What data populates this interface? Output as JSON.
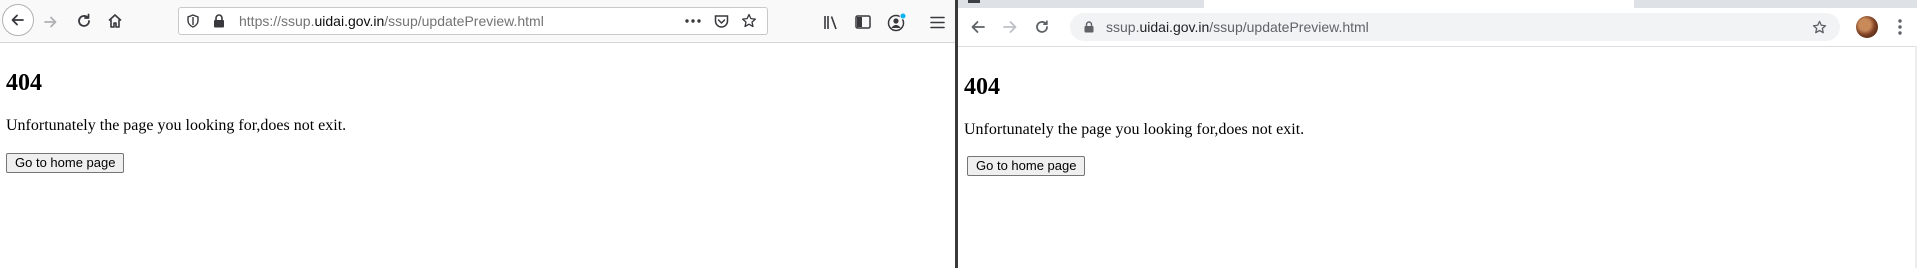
{
  "firefox": {
    "url_prefix": "https://ssup.",
    "url_domain": "uidai.gov.in",
    "url_path": "/ssup/updatePreview.html",
    "page": {
      "heading": "404",
      "message": "Unfortunately the page you looking for,does not exit.",
      "button_label": "Go to home page"
    }
  },
  "chrome": {
    "url_prefix": "ssup.",
    "url_domain": "uidai.gov.in",
    "url_path": "/ssup/updatePreview.html",
    "page": {
      "heading": "404",
      "message": "Unfortunately the page you looking for,does not exit.",
      "button_label": "Go to home page"
    }
  },
  "icons": {
    "firefox": [
      "back-icon",
      "forward-icon",
      "reload-icon",
      "home-icon",
      "shield-icon",
      "lock-icon",
      "more-actions-icon",
      "pocket-icon",
      "bookmark-star-icon",
      "library-icon",
      "sidebar-icon",
      "account-icon",
      "hamburger-menu-icon"
    ],
    "chrome": [
      "back-icon",
      "forward-icon",
      "reload-icon",
      "lock-icon",
      "bookmark-star-icon",
      "profile-avatar",
      "kebab-menu-icon"
    ]
  },
  "colors": {
    "firefox_toolbar": "#f9f9fa",
    "chrome_omnibox": "#f1f3f4",
    "account_dot": "#00b3f4"
  }
}
